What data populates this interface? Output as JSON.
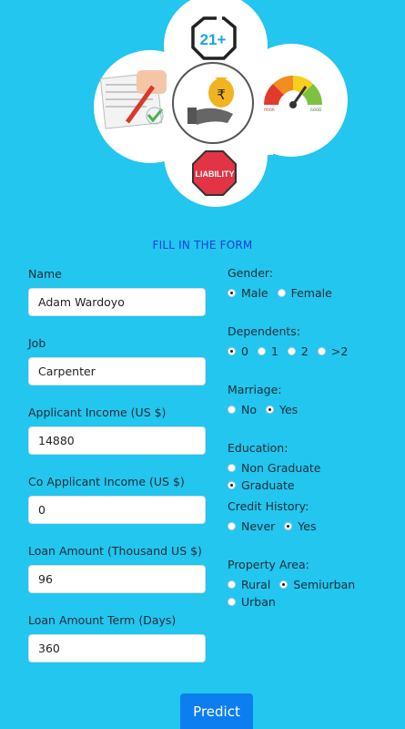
{
  "header": {
    "age_badge": "21+",
    "rupee_symbol": "₹",
    "stop_sign_text": "LIABILITY",
    "gauge_low": "POOR",
    "gauge_high": "GOOD"
  },
  "form": {
    "title": "FILL IN THE FORM",
    "fields": [
      {
        "label": "Name",
        "value": "Adam Wardoyo"
      },
      {
        "label": "Job",
        "value": "Carpenter"
      },
      {
        "label": "Applicant Income (US $)",
        "value": "14880"
      },
      {
        "label": "Co Applicant Income (US $)",
        "value": "0"
      },
      {
        "label": "Loan Amount (Thousand US $)",
        "value": "96"
      },
      {
        "label": "Loan Amount Term (Days)",
        "value": "360"
      }
    ],
    "gender": {
      "label": "Gender:",
      "options": [
        "Male",
        "Female"
      ],
      "selected": "Male"
    },
    "dependents": {
      "label": "Dependents:",
      "options": [
        "0",
        "1",
        "2",
        ">2"
      ],
      "selected": "0"
    },
    "marriage": {
      "label": "Marriage:",
      "options": [
        "No",
        "Yes"
      ],
      "selected": "Yes"
    },
    "education": {
      "label": "Education:",
      "options": [
        "Non Graduate",
        "Graduate"
      ],
      "selected": "Graduate"
    },
    "credit_history": {
      "label": "Credit History:",
      "options": [
        "Never",
        "Yes"
      ],
      "selected": "Yes"
    },
    "property_area": {
      "label": "Property Area:",
      "options": [
        "Rural",
        "Semiurban",
        "Urban"
      ],
      "selected": "Semiurban"
    },
    "submit_label": "Predict"
  },
  "colors": {
    "background": "#22c6ee",
    "title": "#1b3fd8",
    "button": "#0c7ef0"
  }
}
